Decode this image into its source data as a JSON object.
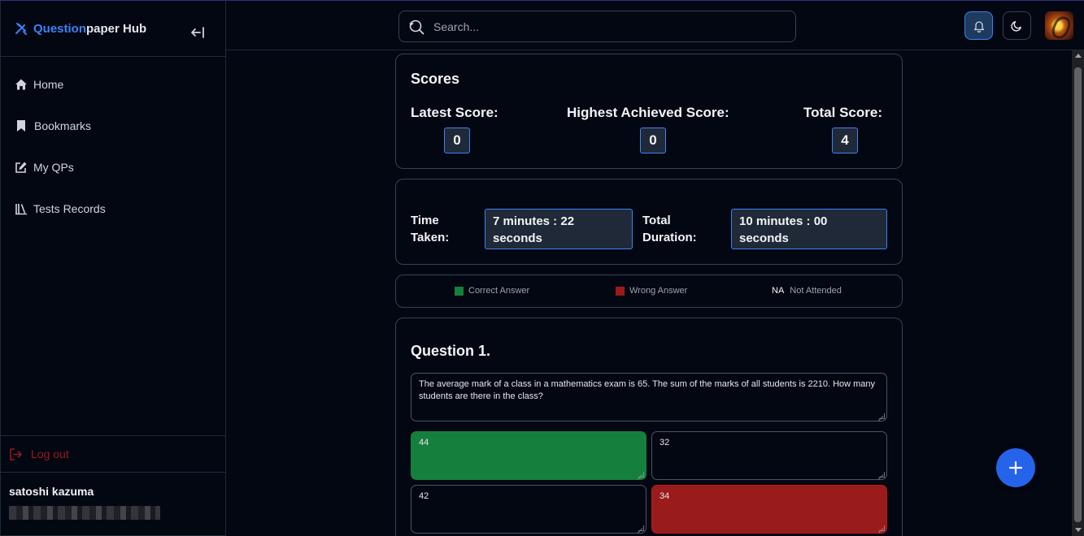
{
  "sidebar": {
    "brand_part1": "Question",
    "brand_part2": "paper Hub",
    "items": [
      {
        "label": "Home",
        "icon": "home-icon"
      },
      {
        "label": "Bookmarks",
        "icon": "bookmark-icon"
      },
      {
        "label": "My QPs",
        "icon": "edit-icon"
      },
      {
        "label": "Tests Records",
        "icon": "library-icon"
      }
    ],
    "logout_label": "Log out",
    "user_name": "satoshi kazuma"
  },
  "topbar": {
    "search_placeholder": "Search..."
  },
  "scores": {
    "title": "Scores",
    "latest_label": "Latest Score:",
    "latest_value": "0",
    "highest_label": "Highest Achieved Score:",
    "highest_value": "0",
    "total_label": "Total Score:",
    "total_value": "4"
  },
  "time": {
    "taken_label_1": "Time",
    "taken_label_2": "Taken:",
    "taken_value_1": "7 minutes : 22",
    "taken_value_2": "seconds",
    "duration_label_1": "Total",
    "duration_label_2": "Duration:",
    "duration_value_1": "10 minutes : 00",
    "duration_value_2": "seconds"
  },
  "legend": {
    "correct": "Correct Answer",
    "wrong": "Wrong Answer",
    "na_tag": "NA",
    "not_attended": "Not Attended",
    "correct_color": "#15803d",
    "wrong_color": "#991b1b"
  },
  "question": {
    "title": "Question 1.",
    "text": "The average mark of a class in a mathematics exam is 65. The sum of the marks of all students is 2210. How many students are there in the class?",
    "options": [
      "44",
      "32",
      "42",
      "34"
    ]
  }
}
